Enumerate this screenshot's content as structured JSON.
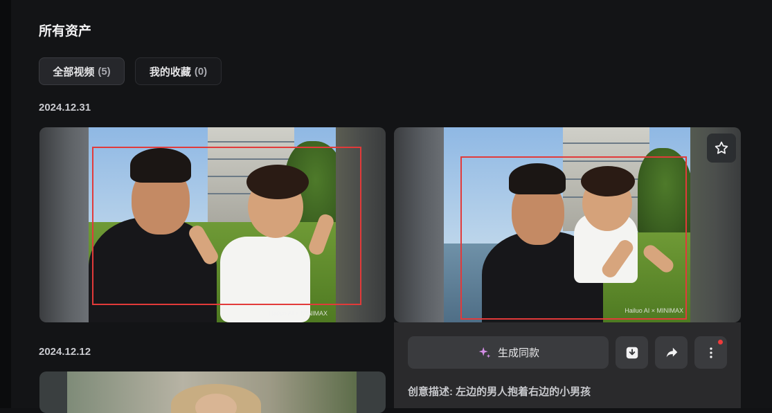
{
  "page": {
    "title": "所有资产"
  },
  "tabs": [
    {
      "label": "全部视频",
      "count": "(5)"
    },
    {
      "label": "我的收藏",
      "count": "(0)"
    }
  ],
  "groups": [
    {
      "date": "2024.12.31"
    },
    {
      "date": "2024.12.12"
    }
  ],
  "video_cards": [
    {
      "watermark": "Hailuo AI × MINIMAX"
    },
    {
      "watermark": "Hailuo AI × MINIMAX"
    }
  ],
  "actions": {
    "generate_label": "生成同款"
  },
  "description": {
    "label": "创意描述:",
    "text": "左边的男人抱着右边的小男孩"
  },
  "colors": {
    "background": "#131416",
    "panel": "#2a2a2c",
    "button": "#3a3b3e",
    "detection_box": "#e23a3a",
    "notification_dot": "#ef3b3b",
    "sparkle": "#d48ee6"
  },
  "icons": [
    "star-icon",
    "sparkle-icon",
    "download-icon",
    "share-icon",
    "more-icon"
  ]
}
